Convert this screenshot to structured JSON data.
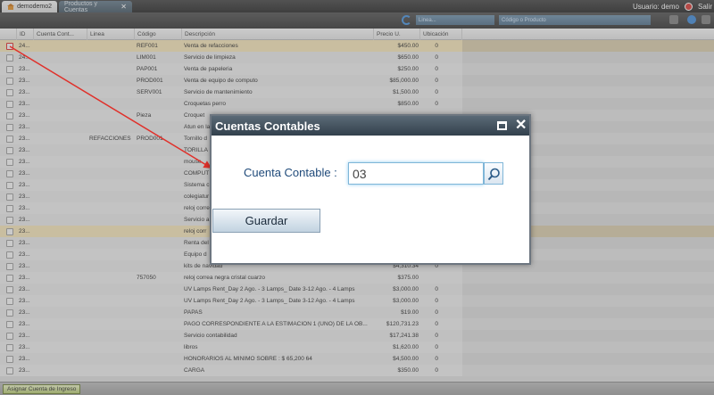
{
  "tabs": [
    {
      "label": "demodemo2"
    },
    {
      "label": "Productos y Cuentas"
    }
  ],
  "user": {
    "label": "Usuario: demo",
    "logout_label": "Salir"
  },
  "toolbar": {
    "linea_placeholder": "Linea...",
    "codigo_placeholder": "Código o Producto"
  },
  "grid": {
    "columns": [
      "ID",
      "Cuenta Cont...",
      "Linea",
      "Código",
      "Descripción",
      "Precio U.",
      "Ubicación"
    ],
    "rows": [
      {
        "id": "24...",
        "cuenta": "",
        "linea": "",
        "codigo": "REF001",
        "descripcion": "Venta de refacciones",
        "precio": "$450.00",
        "ubicacion": "0",
        "highlight": true,
        "checked": true
      },
      {
        "id": "24...",
        "cuenta": "",
        "linea": "",
        "codigo": "LIM001",
        "descripcion": "Servicio de limpieza",
        "precio": "$650.00",
        "ubicacion": "0"
      },
      {
        "id": "23...",
        "cuenta": "",
        "linea": "",
        "codigo": "PAP001",
        "descripcion": "Venta de papeleria",
        "precio": "$250.00",
        "ubicacion": "0"
      },
      {
        "id": "23...",
        "cuenta": "",
        "linea": "",
        "codigo": "PROD001",
        "descripcion": "Venta de equipo de computo",
        "precio": "$85,000.00",
        "ubicacion": "0"
      },
      {
        "id": "23...",
        "cuenta": "",
        "linea": "",
        "codigo": "SERV001",
        "descripcion": "Servicio de mantenimiento",
        "precio": "$1,500.00",
        "ubicacion": "0"
      },
      {
        "id": "23...",
        "cuenta": "",
        "linea": "",
        "codigo": "",
        "descripcion": "Croquetas perro",
        "precio": "$850.00",
        "ubicacion": "0"
      },
      {
        "id": "23...",
        "cuenta": "",
        "linea": "",
        "codigo": "Pieza",
        "descripcion": "Croquet",
        "precio": "",
        "ubicacion": ""
      },
      {
        "id": "23...",
        "cuenta": "",
        "linea": "",
        "codigo": "",
        "descripcion": "Atun en la",
        "precio": "",
        "ubicacion": ""
      },
      {
        "id": "23...",
        "cuenta": "",
        "linea": "REFACCIONES",
        "codigo": "PROD001",
        "descripcion": "Tornillo d",
        "precio": "",
        "ubicacion": ""
      },
      {
        "id": "23...",
        "cuenta": "",
        "linea": "",
        "codigo": "",
        "descripcion": "TORILLA",
        "precio": "",
        "ubicacion": ""
      },
      {
        "id": "23...",
        "cuenta": "",
        "linea": "",
        "codigo": "",
        "descripcion": "mouse",
        "precio": "",
        "ubicacion": ""
      },
      {
        "id": "23...",
        "cuenta": "",
        "linea": "",
        "codigo": "",
        "descripcion": "COMPUT",
        "precio": "",
        "ubicacion": ""
      },
      {
        "id": "23...",
        "cuenta": "",
        "linea": "",
        "codigo": "",
        "descripcion": "Sistema c",
        "precio": "",
        "ubicacion": ""
      },
      {
        "id": "23...",
        "cuenta": "",
        "linea": "",
        "codigo": "",
        "descripcion": "colegiatur",
        "precio": "",
        "ubicacion": ""
      },
      {
        "id": "23...",
        "cuenta": "",
        "linea": "",
        "codigo": "",
        "descripcion": "reloj corre",
        "precio": "",
        "ubicacion": ""
      },
      {
        "id": "23...",
        "cuenta": "",
        "linea": "",
        "codigo": "",
        "descripcion": "Servicio a",
        "precio": "",
        "ubicacion": ""
      },
      {
        "id": "23...",
        "cuenta": "",
        "linea": "",
        "codigo": "",
        "descripcion": "reloj corr",
        "precio": "",
        "ubicacion": "",
        "highlight": true
      },
      {
        "id": "23...",
        "cuenta": "",
        "linea": "",
        "codigo": "",
        "descripcion": "Renta del",
        "precio": "",
        "ubicacion": ""
      },
      {
        "id": "23...",
        "cuenta": "",
        "linea": "",
        "codigo": "",
        "descripcion": "Equipo d",
        "precio": "",
        "ubicacion": ""
      },
      {
        "id": "23...",
        "cuenta": "",
        "linea": "",
        "codigo": "",
        "descripcion": "kits de navidad",
        "precio": "$4,310.34",
        "ubicacion": "0"
      },
      {
        "id": "23...",
        "cuenta": "",
        "linea": "",
        "codigo": "757050",
        "descripcion": "reloj correa negra cristal cuarzo",
        "precio": "$375.00",
        "ubicacion": ""
      },
      {
        "id": "23...",
        "cuenta": "",
        "linea": "",
        "codigo": "",
        "descripcion": "UV Lamps Rent_Day 2 Ago. - 3 Lamps_ Date 3-12 Ago. - 4 Lamps",
        "precio": "$3,000.00",
        "ubicacion": "0"
      },
      {
        "id": "23...",
        "cuenta": "",
        "linea": "",
        "codigo": "",
        "descripcion": "UV Lamps Rent_Day 2 Ago. - 3 Lamps_ Date 3-12 Ago. - 4 Lamps",
        "precio": "$3,000.00",
        "ubicacion": "0"
      },
      {
        "id": "23...",
        "cuenta": "",
        "linea": "",
        "codigo": "",
        "descripcion": "PAPAS",
        "precio": "$19.00",
        "ubicacion": "0"
      },
      {
        "id": "23...",
        "cuenta": "",
        "linea": "",
        "codigo": "",
        "descripcion": "PAGO CORRESPONDIENTE A LA ESTIMACION 1 (UNO) DE LA OB...",
        "precio": "$120,731.23",
        "ubicacion": "0"
      },
      {
        "id": "23...",
        "cuenta": "",
        "linea": "",
        "codigo": "",
        "descripcion": "Servicio contabilidad",
        "precio": "$17,241.38",
        "ubicacion": "0"
      },
      {
        "id": "23...",
        "cuenta": "",
        "linea": "",
        "codigo": "",
        "descripcion": "libros",
        "precio": "$1,620.00",
        "ubicacion": "0"
      },
      {
        "id": "23...",
        "cuenta": "",
        "linea": "",
        "codigo": "",
        "descripcion": "HONORARIOS AL MINIMO SOBRE : $ 65,200 64",
        "precio": "$4,500.00",
        "ubicacion": "0"
      },
      {
        "id": "23...",
        "cuenta": "",
        "linea": "",
        "codigo": "",
        "descripcion": "CARGA",
        "precio": "$350.00",
        "ubicacion": "0"
      }
    ]
  },
  "bottom": {
    "assign_button": "Asignar Cuenta de Ingreso"
  },
  "modal": {
    "title": "Cuentas Contables",
    "field_label": "Cuenta Contable :",
    "field_value": "03",
    "save_button": "Guardar"
  },
  "colors": {
    "accent": "#3f5260",
    "highlight_row": "#f4e3b6",
    "annotation_arrow": "#e0302a"
  }
}
